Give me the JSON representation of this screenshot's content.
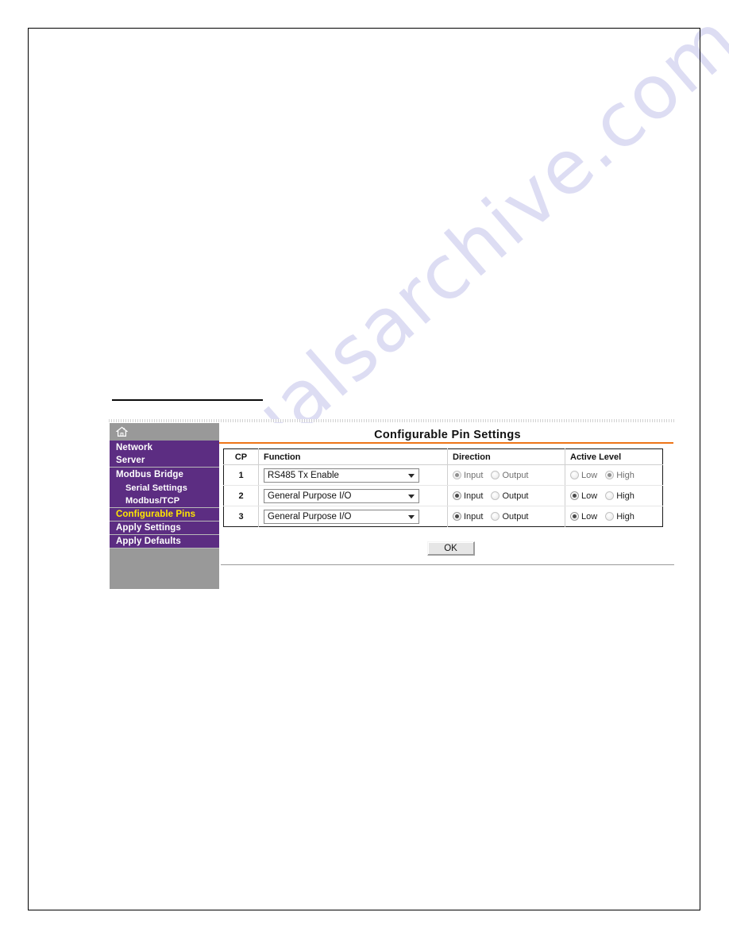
{
  "watermark": {
    "text": "manualsarchive.com"
  },
  "sidebar": {
    "home_icon": "home-icon",
    "items": [
      {
        "label": "Network",
        "type": "top",
        "active": false
      },
      {
        "label": "Server",
        "type": "top",
        "active": false
      },
      {
        "label": "Modbus Bridge",
        "type": "top",
        "active": false
      },
      {
        "label": "Serial Settings",
        "type": "sub",
        "active": false
      },
      {
        "label": "Modbus/TCP",
        "type": "sub",
        "active": false
      },
      {
        "label": "Configurable Pins",
        "type": "top",
        "active": true
      },
      {
        "label": "Apply Settings",
        "type": "top",
        "active": false
      },
      {
        "label": "Apply Defaults",
        "type": "top",
        "active": false
      }
    ]
  },
  "content": {
    "title": "Configurable Pin Settings",
    "table": {
      "headers": [
        "CP",
        "Function",
        "Direction",
        "Active Level"
      ],
      "rows": [
        {
          "cp": "1",
          "function": "RS485 Tx Enable",
          "direction": {
            "options": [
              "Input",
              "Output"
            ],
            "selected": "Input",
            "dimmed": true
          },
          "active_level": {
            "options": [
              "Low",
              "High"
            ],
            "selected": "High",
            "dimmed": true
          }
        },
        {
          "cp": "2",
          "function": "General Purpose I/O",
          "direction": {
            "options": [
              "Input",
              "Output"
            ],
            "selected": "Input",
            "dimmed": false
          },
          "active_level": {
            "options": [
              "Low",
              "High"
            ],
            "selected": "Low",
            "dimmed": false
          }
        },
        {
          "cp": "3",
          "function": "General Purpose I/O",
          "direction": {
            "options": [
              "Input",
              "Output"
            ],
            "selected": "Input",
            "dimmed": false
          },
          "active_level": {
            "options": [
              "Low",
              "High"
            ],
            "selected": "Low",
            "dimmed": false
          }
        }
      ]
    },
    "ok_label": "OK"
  },
  "colors": {
    "nav_purple": "#5c2d82",
    "nav_active_text": "#ffe600",
    "accent_orange": "#ee7518",
    "sidebar_grey": "#999999",
    "watermark": "#d8d8f2"
  }
}
